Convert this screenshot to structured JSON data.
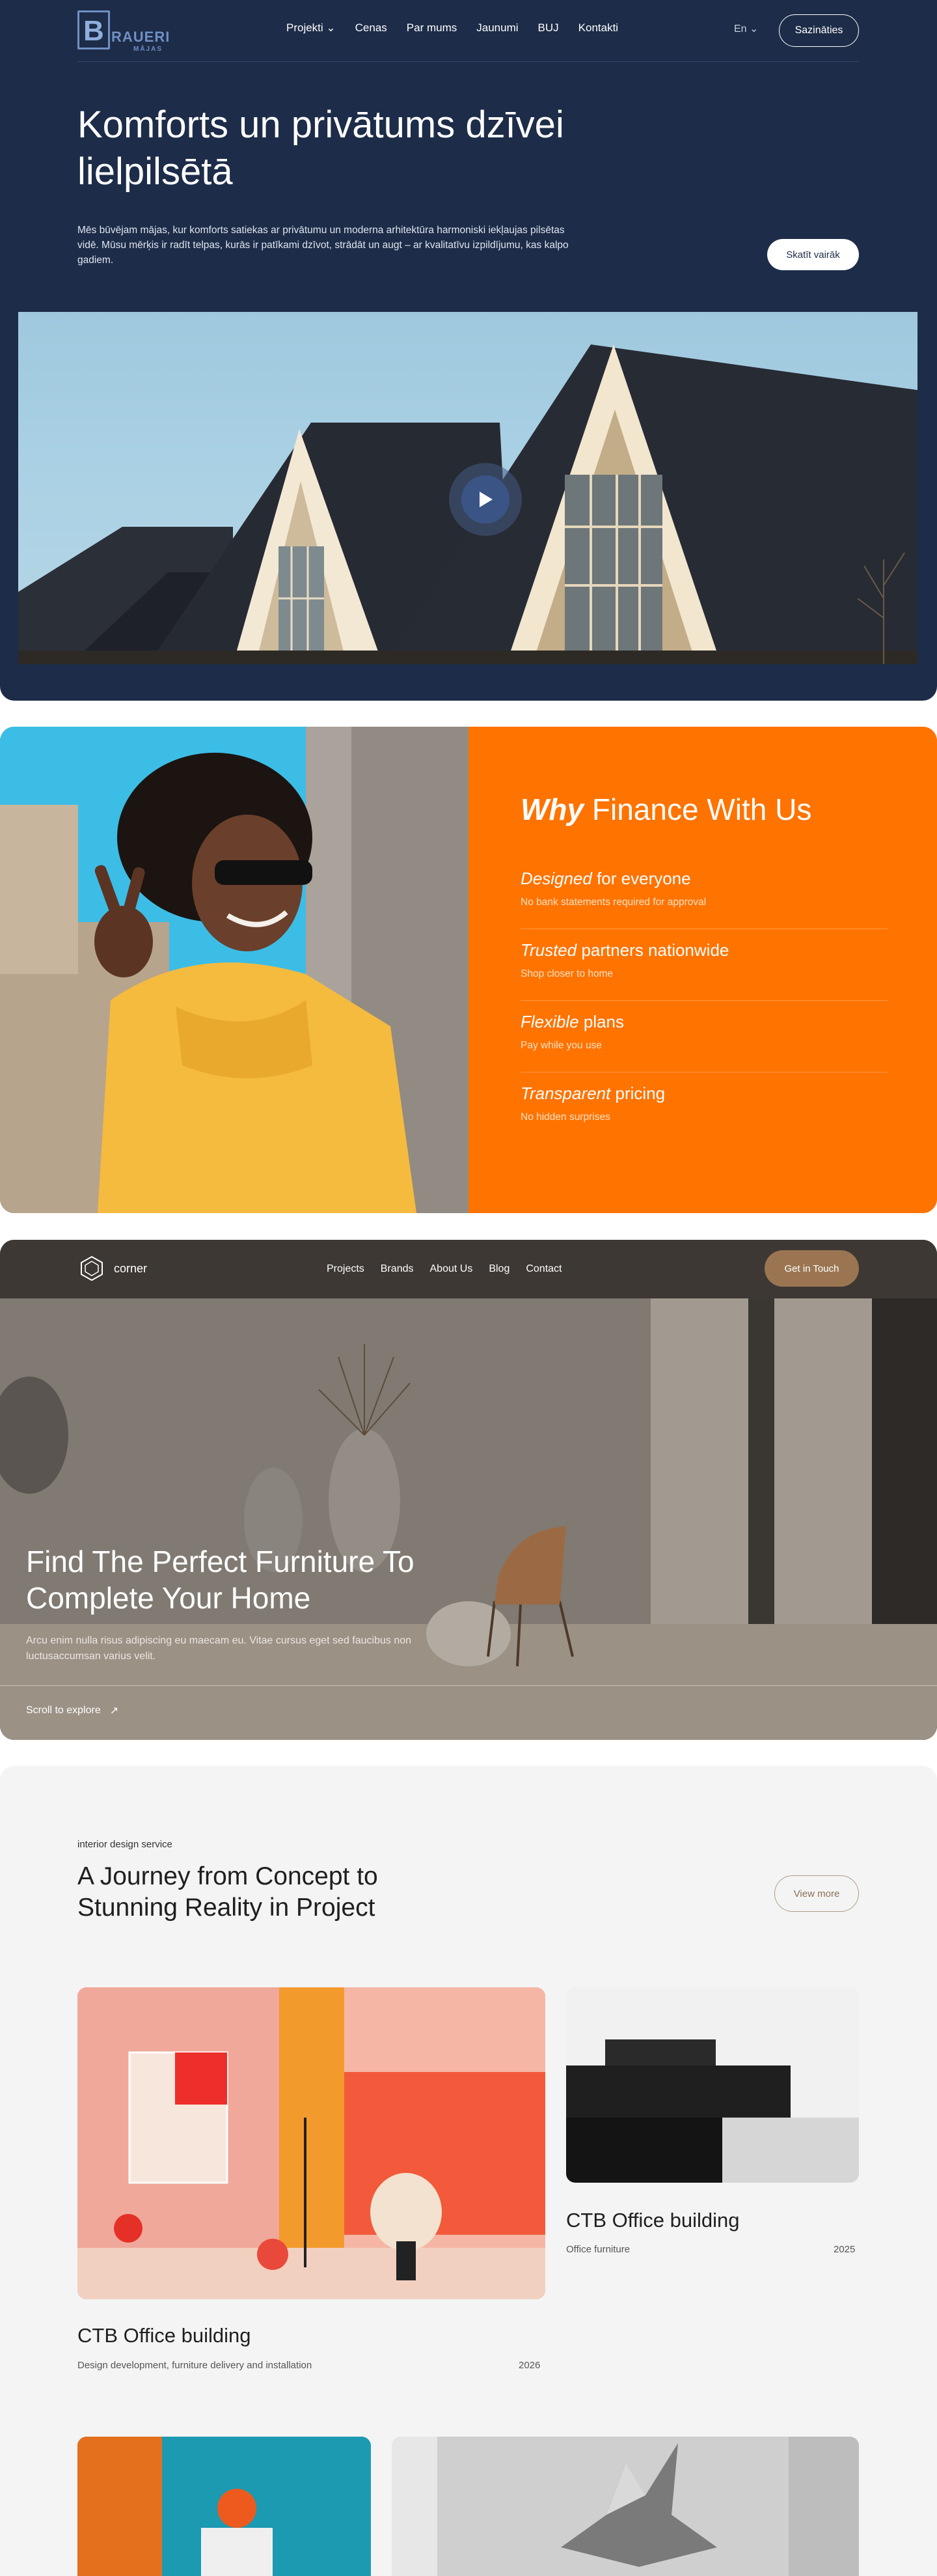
{
  "brauer": {
    "logo": {
      "mark": "B",
      "name": "RAUERI",
      "sub": "MĀJAS"
    },
    "nav": [
      "Projekti ⌄",
      "Cenas",
      "Par mums",
      "Jaunumi",
      "BUJ",
      "Kontakti"
    ],
    "lang": "En ⌄",
    "contact_label": "Sazināties",
    "title": "Komforts un privātums dzīvei lielpilsētā",
    "lead": "Mēs būvējam mājas, kur komforts satiekas ar privātumu un moderna arhitektūra harmoniski iekļaujas pilsētas vidē. Mūsu mērķis ir radīt telpas, kurās ir patīkami dzīvot, strādāt un augt – ar kvalitatīvu izpildījumu, kas kalpo gadiem.",
    "more_label": "Skatīt vairāk"
  },
  "finance": {
    "title_em": "Why",
    "title_rest": " Finance With Us",
    "items": [
      {
        "em": "Designed",
        "rest": " for everyone",
        "desc": "No bank statements required for approval"
      },
      {
        "em": "Trusted",
        "rest": " partners nationwide",
        "desc": "Shop closer to home"
      },
      {
        "em": "Flexible",
        "rest": " plans",
        "desc": "Pay while you use"
      },
      {
        "em": "Transparent",
        "rest": " pricing",
        "desc": "No hidden surprises"
      }
    ]
  },
  "corner": {
    "logo": "corner",
    "nav": [
      "Projects",
      "Brands",
      "About Us",
      "Blog",
      "Contact"
    ],
    "cta": "Get in Touch",
    "title": "Find The Perfect Furniture To Complete Your Home",
    "lead": "Arcu enim nulla risus adipiscing eu maecam eu. Vitae cursus eget sed faucibus non luctusaccumsan varius velit.",
    "scroll": "Scroll to explore",
    "scroll_arrow": "↗"
  },
  "journey": {
    "eyebrow": "interior design service",
    "title": "A Journey from Concept to Stunning Reality in Project",
    "view_more": "View more",
    "cards": [
      {
        "title": "CTB Office building",
        "desc": "Design development, furniture delivery and installation",
        "year": "2026"
      },
      {
        "title": "CTB Office building",
        "desc": "Office furniture",
        "year": "2025"
      }
    ]
  },
  "icons": [
    "play-icon",
    "corner-logo-icon",
    "arrow-up-right-icon"
  ],
  "colors": {
    "navy": "#1d2c48",
    "orange": "#ff7300",
    "bronze": "#9b7552",
    "light": "#f4f4f4"
  }
}
